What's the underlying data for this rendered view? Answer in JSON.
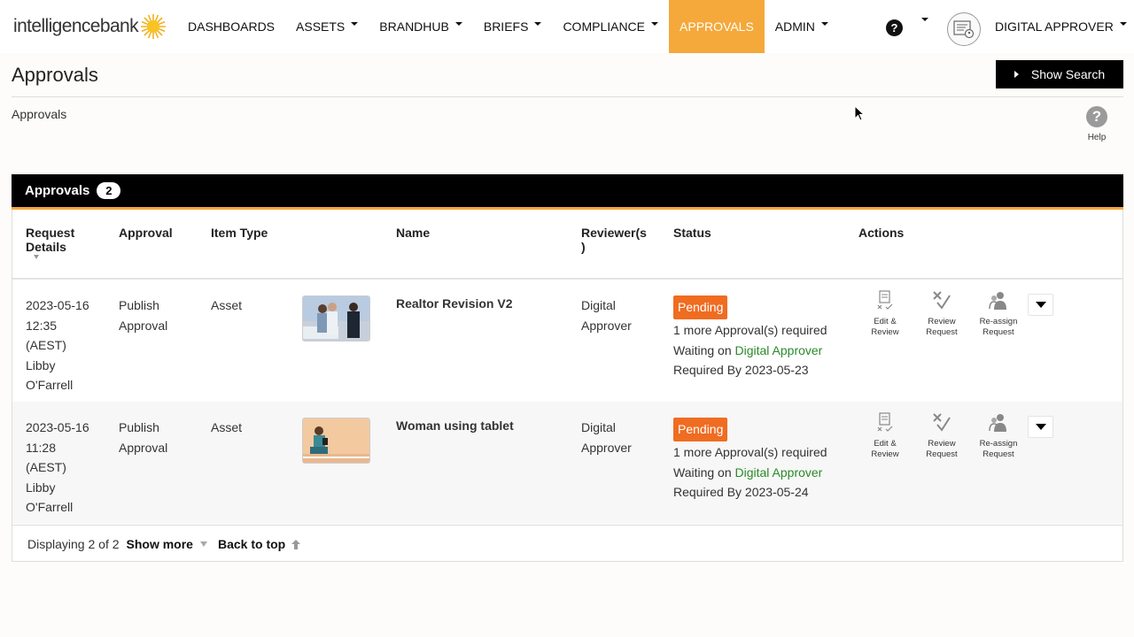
{
  "brand": {
    "logo_text": "intelligencebank"
  },
  "nav": {
    "items": [
      {
        "label": "DASHBOARDS",
        "dropdown": false,
        "active": false
      },
      {
        "label": "ASSETS",
        "dropdown": true,
        "active": false
      },
      {
        "label": "BRANDHUB",
        "dropdown": true,
        "active": false
      },
      {
        "label": "BRIEFS",
        "dropdown": true,
        "active": false
      },
      {
        "label": "COMPLIANCE",
        "dropdown": true,
        "active": false
      },
      {
        "label": "APPROVALS",
        "dropdown": false,
        "active": true
      },
      {
        "label": "ADMIN",
        "dropdown": true,
        "active": false
      }
    ],
    "help_glyph": "?",
    "user_name": "DIGITAL APPROVER",
    "accent_color": "#f4a93a"
  },
  "page": {
    "title": "Approvals",
    "show_search_label": "Show Search",
    "breadcrumb": "Approvals",
    "help_glyph": "?",
    "help_label": "Help"
  },
  "panel": {
    "title": "Approvals",
    "count": "2",
    "columns": {
      "request_details_1": "Request",
      "request_details_2": "Details",
      "approval": "Approval",
      "item_type": "Item Type",
      "name": "Name",
      "reviewers_1": "Reviewer(s",
      "reviewers_2": ")",
      "status": "Status",
      "actions": "Actions"
    },
    "rows": [
      {
        "date": "2023-05-16",
        "time": "12:35",
        "tz": "(AEST)",
        "requester_first": "Libby",
        "requester_last": "O'Farrell",
        "approval_1": "Publish",
        "approval_2": "Approval",
        "item_type": "Asset",
        "name": "Realtor Revision V2",
        "reviewer_1": "Digital",
        "reviewer_2": "Approver",
        "status": "Pending",
        "more_required": "1 more Approval(s) required",
        "waiting_prefix": "Waiting on",
        "waiting_on": "Digital Approver",
        "required_by": "Required By 2023-05-23",
        "thumbnail": "realtor-couple-photo"
      },
      {
        "date": "2023-05-16",
        "time": "11:28",
        "tz": "(AEST)",
        "requester_first": "Libby",
        "requester_last": "O'Farrell",
        "approval_1": "Publish",
        "approval_2": "Approval",
        "item_type": "Asset",
        "name": "Woman using tablet",
        "reviewer_1": "Digital",
        "reviewer_2": "Approver",
        "status": "Pending",
        "more_required": "1 more Approval(s) required",
        "waiting_prefix": "Waiting on",
        "waiting_on": "Digital Approver",
        "required_by": "Required By 2023-05-24",
        "thumbnail": "woman-tablet-photo"
      }
    ],
    "actions": {
      "edit_1": "Edit &",
      "edit_2": "Review",
      "review_1": "Review",
      "review_2": "Request",
      "reassign_1": "Re-assign",
      "reassign_2": "Request"
    },
    "footer": {
      "displaying": "Displaying 2 of 2",
      "show_more": "Show more",
      "back_to_top": "Back to top"
    },
    "status_color": "#ef6c21",
    "link_color": "#2a8a2a"
  }
}
